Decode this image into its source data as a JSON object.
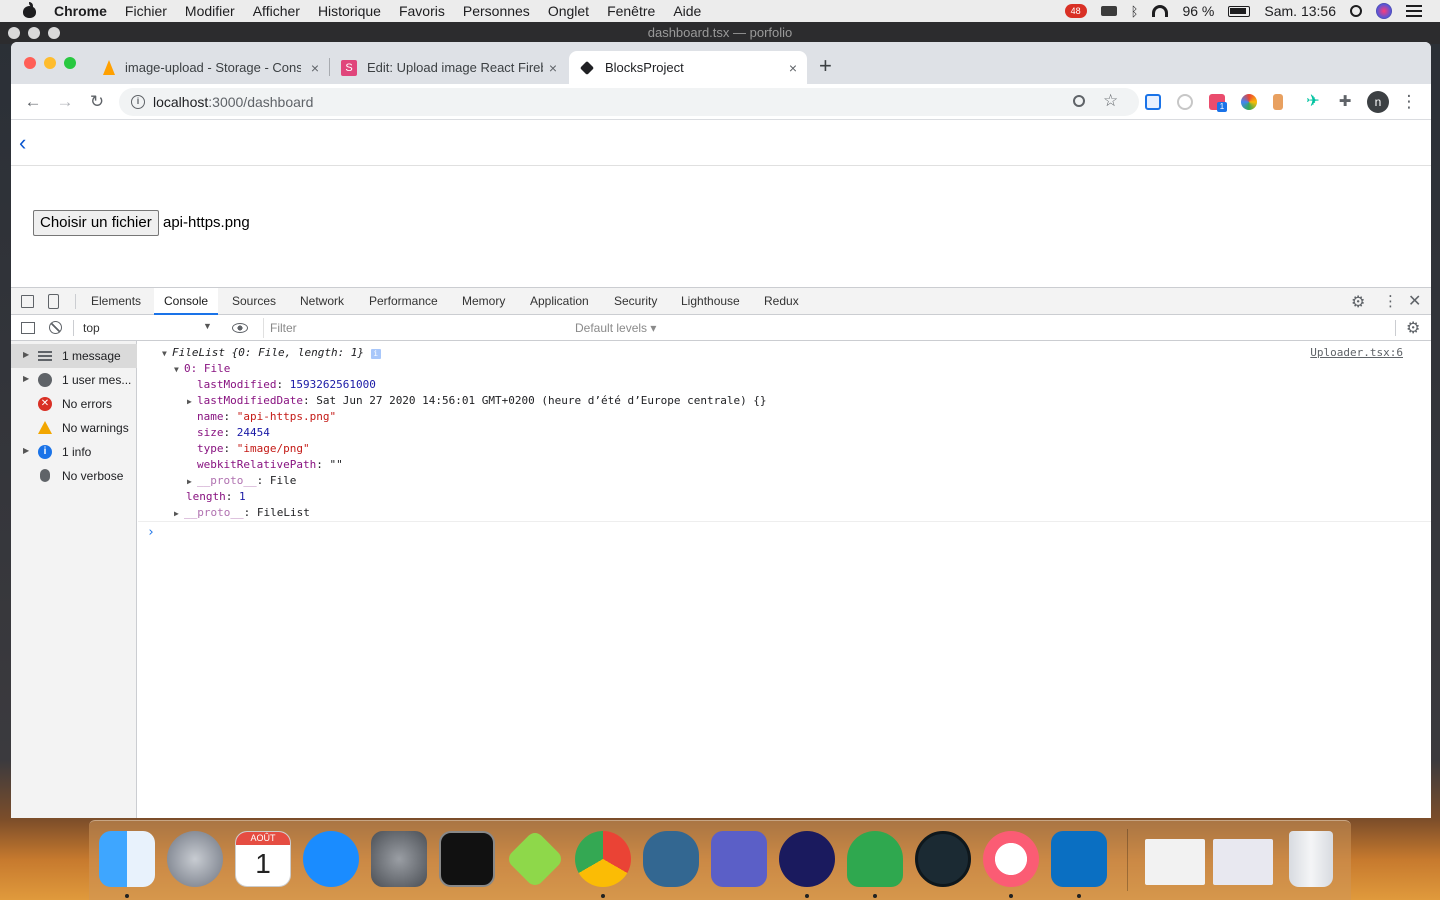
{
  "menubar": {
    "app": "Chrome",
    "items": [
      "Fichier",
      "Modifier",
      "Afficher",
      "Historique",
      "Favoris",
      "Personnes",
      "Onglet",
      "Fenêtre",
      "Aide"
    ],
    "battery": "96 %",
    "clock": "Sam. 13:56",
    "notification_count": "48"
  },
  "terminal_title": "dashboard.tsx — porfolio",
  "browser": {
    "tabs": [
      {
        "title": "image-upload - Storage - Console Firebase",
        "favicon": "firebase-icon",
        "close": "×"
      },
      {
        "title": "Edit: Upload image React Firebase",
        "favicon": "stackedit-icon",
        "close": "×"
      },
      {
        "title": "BlocksProject",
        "favicon": "blocks-icon",
        "close": "×"
      }
    ],
    "new_tab": "+",
    "url_host": "localhost",
    "url_path": ":3000/dashboard",
    "extension_badge": "1",
    "profile_initial": "n"
  },
  "page": {
    "back_glyph": "‹",
    "file_button": "Choisir un fichier",
    "file_name": "api-https.png"
  },
  "devtools": {
    "tabs": [
      "Elements",
      "Console",
      "Sources",
      "Network",
      "Performance",
      "Memory",
      "Application",
      "Security",
      "Lighthouse",
      "Redux"
    ],
    "active_tab": "Console",
    "context": "top",
    "filter_placeholder": "Filter",
    "levels": "Default levels ▾",
    "sidebar": [
      {
        "label": "1 message",
        "icon": "list-icon"
      },
      {
        "label": "1 user mes...",
        "icon": "user-icon"
      },
      {
        "label": "No errors",
        "icon": "error-icon"
      },
      {
        "label": "No warnings",
        "icon": "warning-icon"
      },
      {
        "label": "1 info",
        "icon": "info-icon"
      },
      {
        "label": "No verbose",
        "icon": "bug-icon"
      }
    ],
    "console": {
      "source": "Uploader.tsx:6",
      "header": "FileList {0: File, length: 1}",
      "item0": "0: File",
      "lastModified_key": "lastModified",
      "lastModified_val": "1593262561000",
      "lastModifiedDate_key": "lastModifiedDate",
      "lastModifiedDate_val": "Sat Jun 27 2020 14:56:01 GMT+0200 (heure d’été d’Europe centrale) {}",
      "name_key": "name",
      "name_val": "\"api-https.png\"",
      "size_key": "size",
      "size_val": "24454",
      "type_key": "type",
      "type_val": "\"image/png\"",
      "wrp_key": "webkitRelativePath",
      "wrp_val": "\"\"",
      "proto_file_key": "__proto__",
      "proto_file_val": ": File",
      "length_key": "length",
      "length_val": "1",
      "proto_list_key": "__proto__",
      "proto_list_val": ": FileList",
      "prompt": "›"
    }
  },
  "dock": {
    "calendar_month": "AOÛT",
    "calendar_day": "1",
    "apps": [
      "finder",
      "launchpad",
      "calendar",
      "app-store",
      "system-preferences",
      "terminal",
      "cube-app",
      "chrome",
      "postgres",
      "teams",
      "dropbox",
      "rocket-app",
      "gitkraken",
      "itunes",
      "vscode",
      "recent-window-1",
      "recent-window-2",
      "trash"
    ]
  },
  "colors": {
    "accent": "#1a73e8",
    "active_tab": "#ffffff",
    "tabstrip": "#dee1e6"
  }
}
